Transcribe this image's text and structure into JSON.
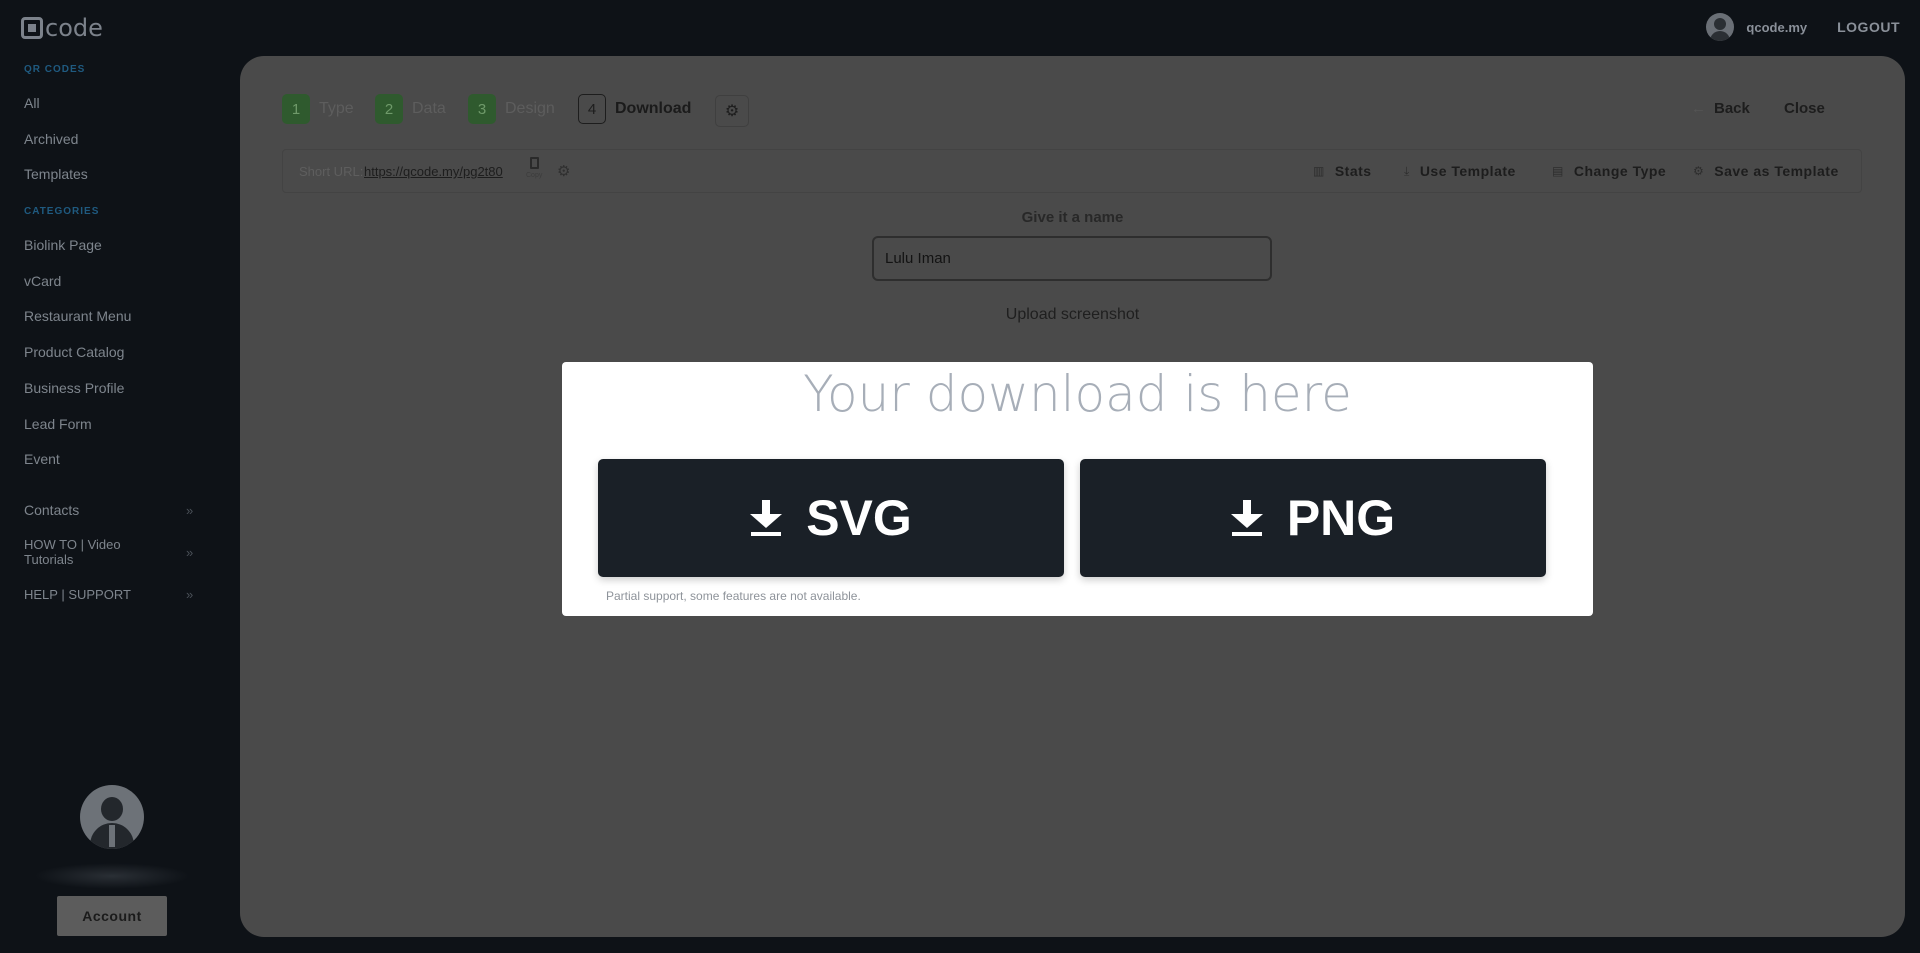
{
  "brand": {
    "logo_text": "code"
  },
  "user": {
    "name": "qcode.my",
    "logout_label": "LOGOUT"
  },
  "sidebar": {
    "qr_codes_heading": "QR CODES",
    "qr_items": [
      "All",
      "Archived",
      "Templates"
    ],
    "categories_heading": "CATEGORIES",
    "category_items": [
      "Biolink Page",
      "vCard",
      "Restaurant Menu",
      "Product Catalog",
      "Business Profile",
      "Lead Form",
      "Event"
    ],
    "expandables": [
      "Contacts",
      "HOW TO | Video Tutorials",
      "HELP | SUPPORT"
    ],
    "account_label": "Account"
  },
  "steps": [
    {
      "num": "1",
      "label": "Type"
    },
    {
      "num": "2",
      "label": "Data"
    },
    {
      "num": "3",
      "label": "Design"
    },
    {
      "num": "4",
      "label": "Download"
    }
  ],
  "nav": {
    "back_label": "Back",
    "close_label": "Close"
  },
  "urlbar": {
    "short_label": "Short URL:",
    "short_url": "https://qcode.my/pg2t80",
    "copy_label": "Copy",
    "actions": [
      "Stats",
      "Use Template",
      "Change Type",
      "Save as Template"
    ]
  },
  "form": {
    "name_label": "Give it a name",
    "name_value": "Lulu Iman",
    "upload_label": "Upload screenshot"
  },
  "modal": {
    "title": "Your download is here",
    "svg_label": "SVG",
    "png_label": "PNG",
    "note": "Partial support, some features are not available."
  },
  "colors": {
    "page_bg": "#0e1217",
    "panel_bg": "#4a4a4a",
    "step_done_bg": "#2f5a2e",
    "modal_bg": "#ffffff",
    "button_bg": "#1a2027",
    "section_heading": "#1f5a80"
  }
}
